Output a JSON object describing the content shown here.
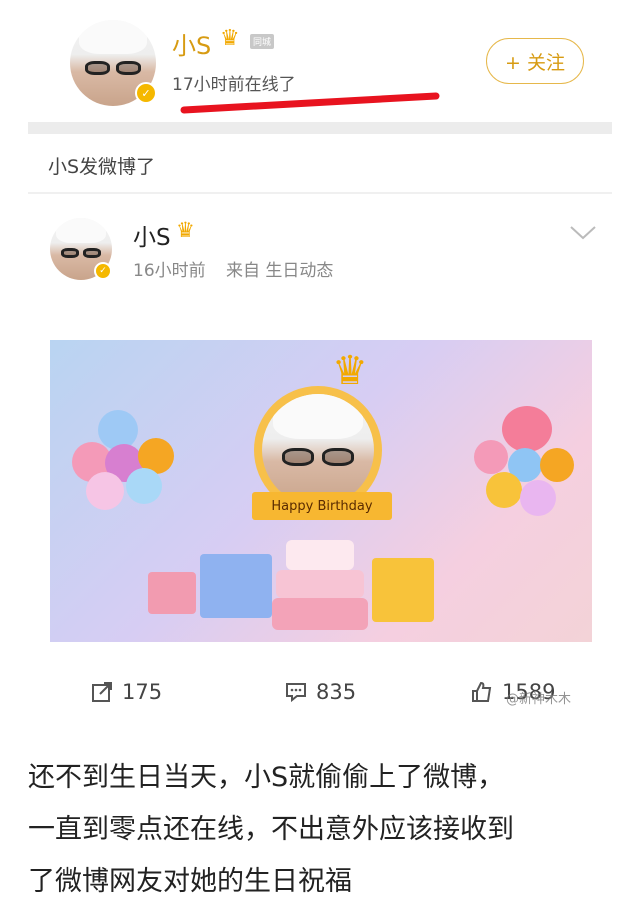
{
  "profile": {
    "name": "小S",
    "level_badge": "同城",
    "online_status": "17小时前在线了",
    "follow_label": "+ 关注"
  },
  "repost_notice": "小S发微博了",
  "post": {
    "author": "小S",
    "time": "16小时前",
    "source": "来自 生日动态",
    "banner_text": "Happy Birthday"
  },
  "stats": {
    "reposts": "175",
    "comments": "835",
    "likes": "1589",
    "watermark": "@新神木木"
  },
  "caption": {
    "line1": "还不到生日当天，小S就偷偷上了微博，",
    "line2": "一直到零点还在线，不出意外应该接收到",
    "line3": "了微博网友对她的生日祝福"
  },
  "colors": {
    "accent": "#f5b800",
    "highlight_line": "#e8131f",
    "follow_border": "#e6b84b"
  }
}
